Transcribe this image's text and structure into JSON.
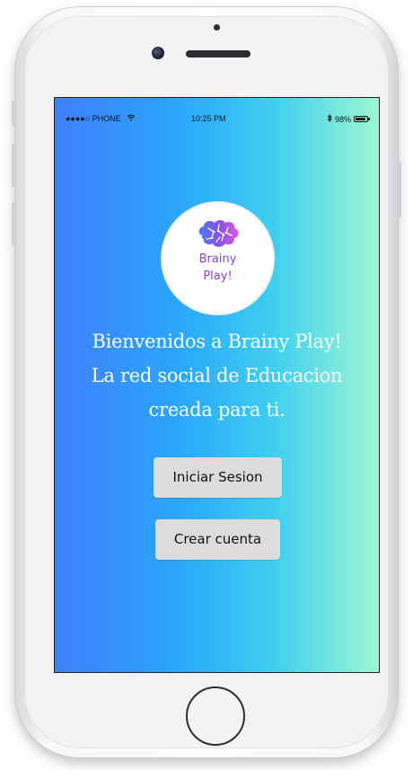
{
  "status_bar": {
    "carrier": "●●●●○ PHONE",
    "time": "10:25 PM",
    "battery_percent": "98%",
    "bluetooth_icon": "bluetooth-icon",
    "wifi_icon": "wifi-icon"
  },
  "logo": {
    "line1": "Brainy",
    "line2": "Play!",
    "icon": "brain-icon",
    "accent_color": "#8b3fd6"
  },
  "welcome": {
    "line1": "Bienvenidos a Brainy Play!",
    "line2": "La red social de Educacion",
    "line3": "creada para ti."
  },
  "buttons": {
    "login_label": "Iniciar Sesion",
    "signup_label": "Crear cuenta"
  },
  "colors": {
    "gradient_start": "#3f7ffb",
    "gradient_end": "#9ef7d2"
  }
}
